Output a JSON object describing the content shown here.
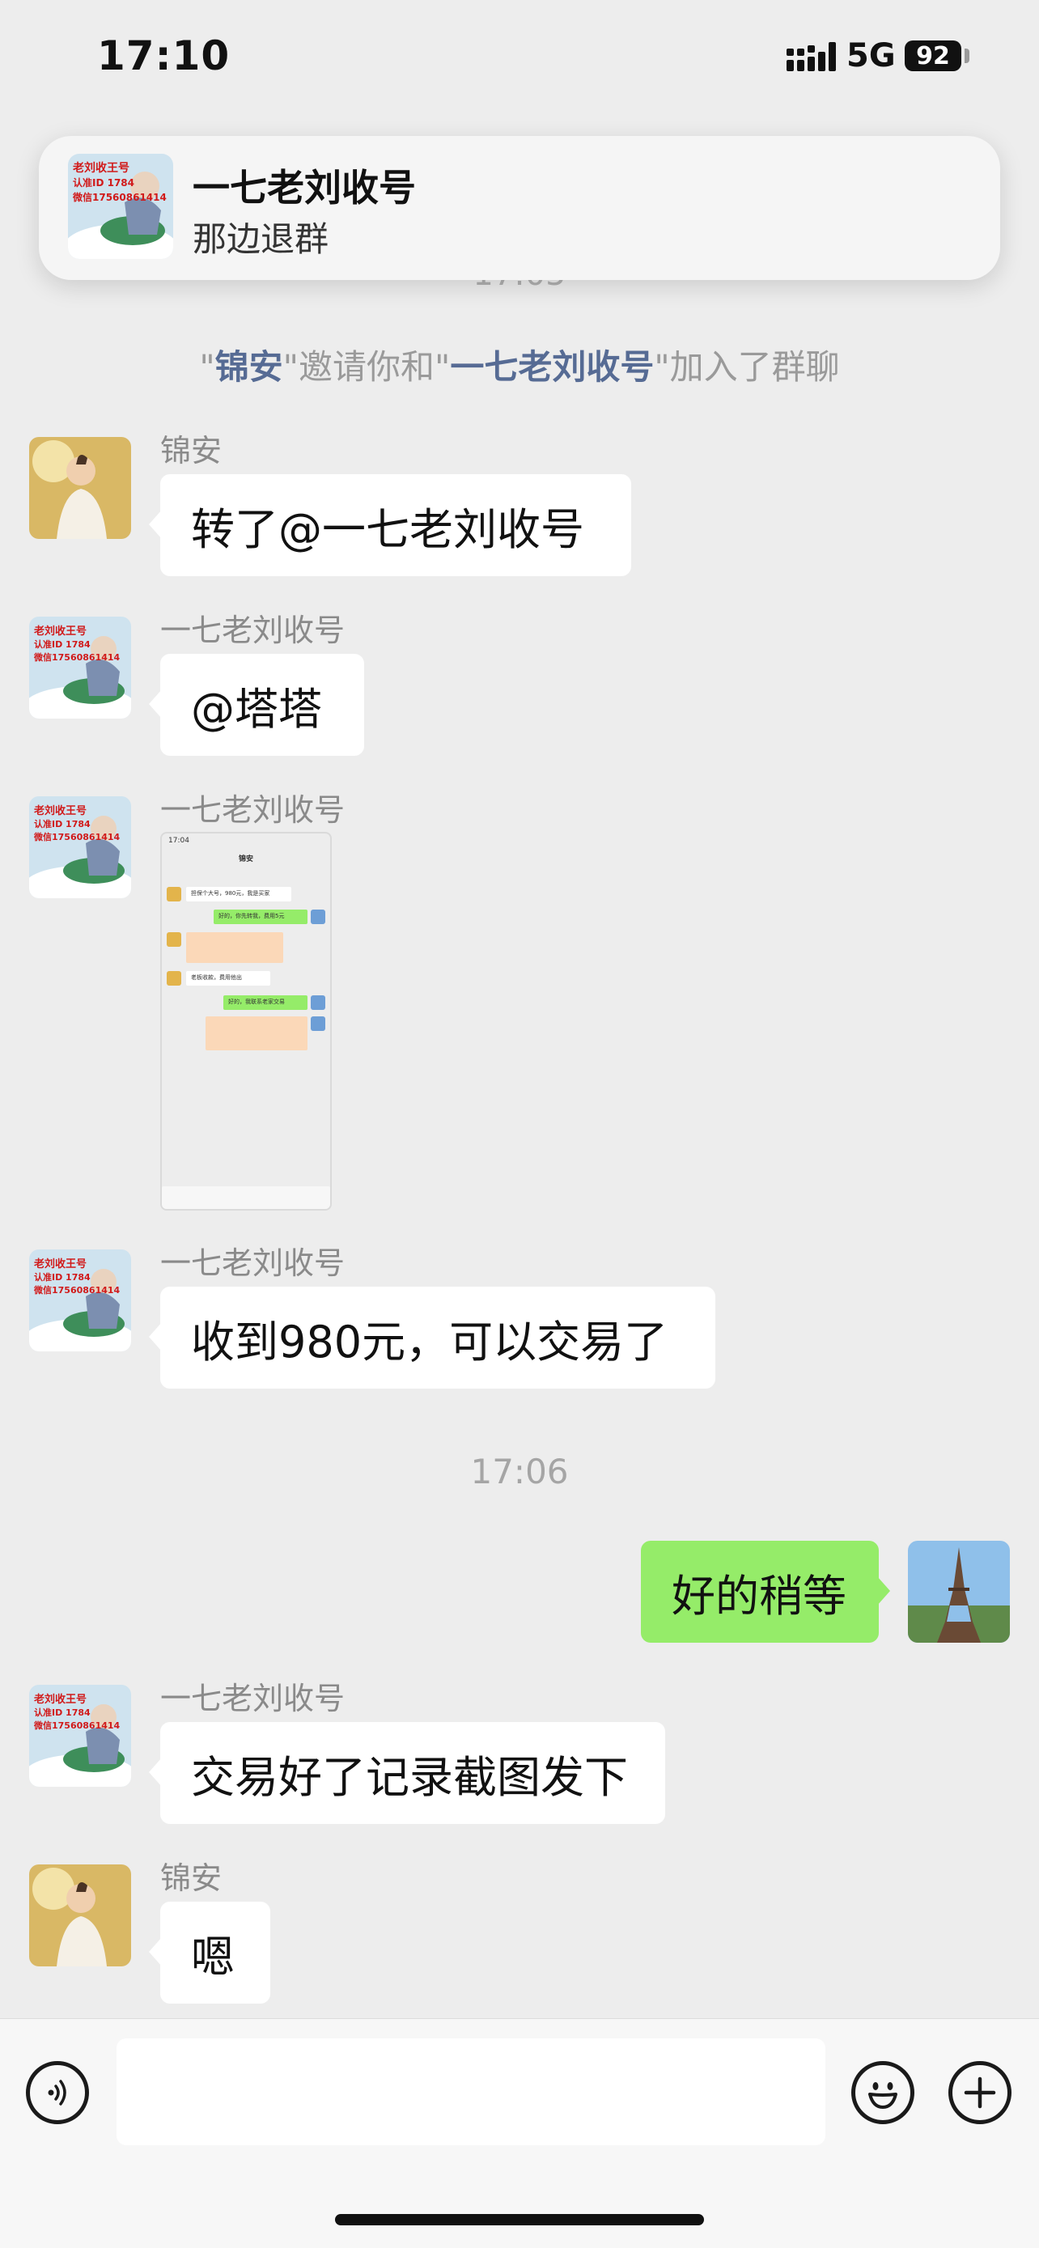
{
  "status_bar": {
    "time": "17:10",
    "network": "5G",
    "battery": "92"
  },
  "notification": {
    "title": "一七老刘收号",
    "message": "那边退群",
    "avatar_lines": [
      "老刘收王号",
      "认准ID 1784",
      "微信17560861414"
    ]
  },
  "chat": {
    "peek_time": "17:05",
    "system_message": {
      "quote_open": "\"",
      "inviter": "锦安",
      "middle": "\"邀请你和\"",
      "invitee": "一七老刘收号",
      "end": "\"加入了群聊"
    },
    "messages": [
      {
        "sender": "锦安",
        "text": "转了@一七老刘收号"
      },
      {
        "sender": "一七老刘收号",
        "text": "@塔塔"
      },
      {
        "sender": "一七老刘收号",
        "type": "image"
      },
      {
        "sender": "一七老刘收号",
        "text": "收到980元，可以交易了"
      },
      {
        "time_separator": "17:06"
      },
      {
        "sender": "me",
        "text": "好的稍等"
      },
      {
        "sender": "一七老刘收号",
        "text": "交易好了记录截图发下"
      },
      {
        "sender": "锦安",
        "text": "嗯"
      }
    ]
  },
  "thumbnail": {
    "time": "17:04",
    "title": "锦安",
    "lines": [
      "担保个大号，980元，我是买家",
      "好的，你先转我，费用5元",
      "老板收款，费用他出",
      "好的，我联系老家交易"
    ]
  },
  "input_bar": {
    "voice_icon": "voice-icon",
    "emoji_icon": "emoji-icon",
    "plus_icon": "plus-icon"
  },
  "colors": {
    "background": "#ededed",
    "incoming_bubble": "#ffffff",
    "outgoing_bubble": "#95ec69",
    "name_link": "#566b94"
  }
}
